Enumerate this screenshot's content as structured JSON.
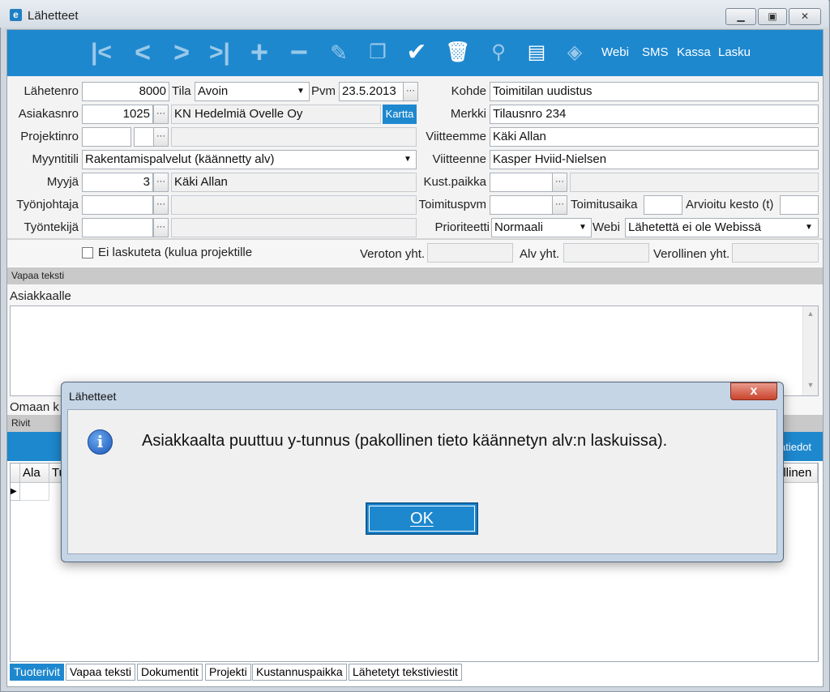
{
  "window": {
    "title": "Lähetteet"
  },
  "toolbar": {
    "icons": [
      "first-icon",
      "prev-icon",
      "next-icon",
      "last-icon",
      "add-icon",
      "remove-icon",
      "edit-icon",
      "copy-icon",
      "confirm-icon",
      "delete-bin-icon",
      "flashlight-icon",
      "print-icon",
      "export-icon"
    ],
    "links": [
      "Webi",
      "SMS",
      "Kassa",
      "Lasku"
    ]
  },
  "form": {
    "lahetenro_label": "Lähetenro",
    "lahetenro": "8000",
    "tila_label": "Tila",
    "tila": "Avoin",
    "pvm_label": "Pvm",
    "pvm": "23.5.2013",
    "kohde_label": "Kohde",
    "kohde": "Toimitilan uudistus",
    "asiakasnro_label": "Asiakasnro",
    "asiakasnro": "1025",
    "asiakas_nimi": "KN Hedelmiä Ovelle Oy",
    "kartta_label": "Kartta",
    "merkki_label": "Merkki",
    "merkki": "Tilausnro 234",
    "projektinro_label": "Projektinro",
    "viitteemme_label": "Viitteemme",
    "viitteemme": "Käki Allan",
    "myyntitili_label": "Myyntitili",
    "myyntitili": "Rakentamispalvelut (käännetty alv)",
    "viitteenne_label": "Viitteenne",
    "viitteenne": "Kasper Hviid-Nielsen",
    "myyja_label": "Myyjä",
    "myyja_nro": "3",
    "myyja_nimi": "Käki Allan",
    "kustpaikka_label": "Kust.paikka",
    "tyonjohtaja_label": "Työnjohtaja",
    "toimituspvm_label": "Toimituspvm",
    "toimitusaika_label": "Toimitusaika",
    "arvioitu_label": "Arvioitu kesto (t)",
    "tyontekija_label": "Työntekijä",
    "prioriteetti_label": "Prioriteetti",
    "prioriteetti": "Normaali",
    "webi_label": "Webi",
    "webi": "Lähetettä ei ole Webissä"
  },
  "totals": {
    "ei_laskuteta": "Ei laskuteta (kulua projektille",
    "veroton_label": "Veroton yht.",
    "alv_label": "Alv yht.",
    "verollinen_label": "Verollinen yht."
  },
  "vapaa_teksti": {
    "section": "Vapaa teksti",
    "asiakkaalle": "Asiakkaalle",
    "omaan_partial": "Omaan k"
  },
  "rivit": {
    "section": "Rivit",
    "toolbar_right": "atiedot",
    "columns": [
      "Ala",
      "Tu"
    ],
    "right_col": "ollinen"
  },
  "tabs": [
    "Tuoterivit",
    "Vapaa teksti",
    "Dokumentit",
    "Projekti",
    "Kustannuspaikka",
    "Lähetetyt tekstiviestit"
  ],
  "dialog": {
    "title": "Lähetteet",
    "close": "x",
    "message": "Asiakkaalta puuttuu y-tunnus (pakollinen tieto käännetyn alv:n laskuissa).",
    "ok": "OK"
  },
  "colors": {
    "accent": "#1e88cf",
    "dialog_frame": "#c5d5e6",
    "close_red": "#c9442d"
  }
}
